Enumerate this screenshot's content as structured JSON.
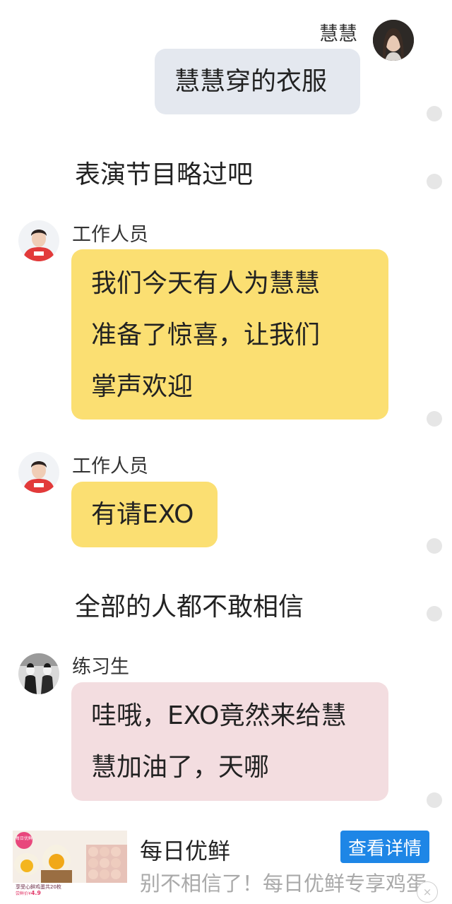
{
  "messages": [
    {
      "speaker": "慧慧",
      "lines": [
        "慧慧穿的衣服"
      ]
    },
    {
      "narration": "表演节目略过吧"
    },
    {
      "speaker": "工作人员",
      "lines": [
        "我们今天有人为慧慧",
        "准备了惊喜，让我们",
        "掌声欢迎"
      ]
    },
    {
      "speaker": "工作人员",
      "lines": [
        "有请EXO"
      ]
    },
    {
      "narration": "全部的人都不敢相信"
    },
    {
      "speaker": "练习生",
      "lines": [
        "哇哦，EXO竟然来给慧",
        "慧加油了，天哪"
      ]
    }
  ],
  "ad": {
    "title": "每日优鲜",
    "description": "别不相信了！每日优鲜专享鸡蛋",
    "button_label": "查看详情",
    "close_icon": "×",
    "image_text": {
      "badge": "每日优鲜",
      "headline": "享受心鲜鸡蛋共20枚",
      "price_prefix": "尝鲜价¥",
      "price": "4.9"
    }
  },
  "colors": {
    "bubble_self": "#e4e8ef",
    "bubble_staff": "#fbdf72",
    "bubble_trainee": "#f3dde0",
    "ad_button": "#1e86e6"
  }
}
